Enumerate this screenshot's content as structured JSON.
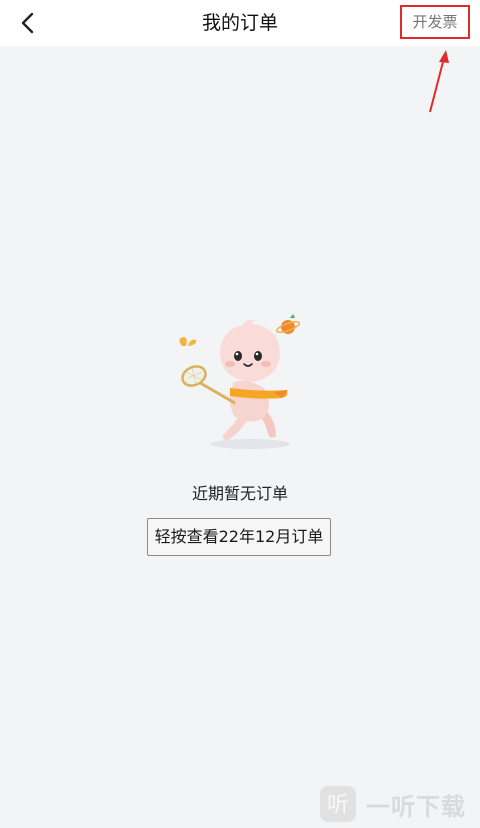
{
  "header": {
    "title": "我的订单",
    "back_icon": "chevron-left-icon",
    "invoice_label": "开发票"
  },
  "empty_state": {
    "illustration": "mascot-with-net-illustration",
    "message": "近期暂无订单",
    "history_button_label": "轻按查看22年12月订单"
  },
  "watermark": {
    "text": "一听下载"
  },
  "colors": {
    "background": "#f3f4f6",
    "header_bg": "#ffffff",
    "annotation": "#e12b2b",
    "mascot_accent": "#f5a623"
  }
}
